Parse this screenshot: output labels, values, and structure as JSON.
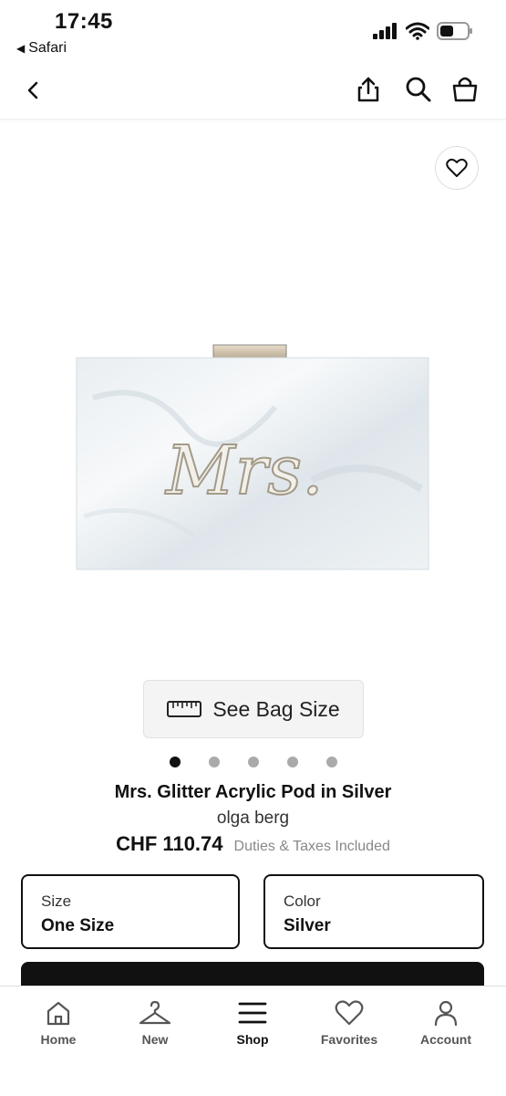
{
  "status": {
    "time": "17:45",
    "back_app": "Safari"
  },
  "product": {
    "see_size_label": "See Bag Size",
    "title": "Mrs. Glitter Acrylic Pod in Silver",
    "brand": "olga berg",
    "price": "CHF 110.74",
    "duties": "Duties & Taxes Included",
    "image_dots": 5,
    "active_dot": 1,
    "bag_script_text": "Mrs."
  },
  "options": {
    "size_label": "Size",
    "size_value": "One Size",
    "color_label": "Color",
    "color_value": "Silver"
  },
  "tabs": [
    {
      "label": "Home",
      "icon": "home-icon"
    },
    {
      "label": "New",
      "icon": "hanger-icon"
    },
    {
      "label": "Shop",
      "icon": "menu-icon",
      "active": true
    },
    {
      "label": "Favorites",
      "icon": "heart-icon"
    },
    {
      "label": "Account",
      "icon": "person-icon"
    }
  ],
  "colors": {
    "primary": "#111111",
    "muted": "#888888"
  }
}
